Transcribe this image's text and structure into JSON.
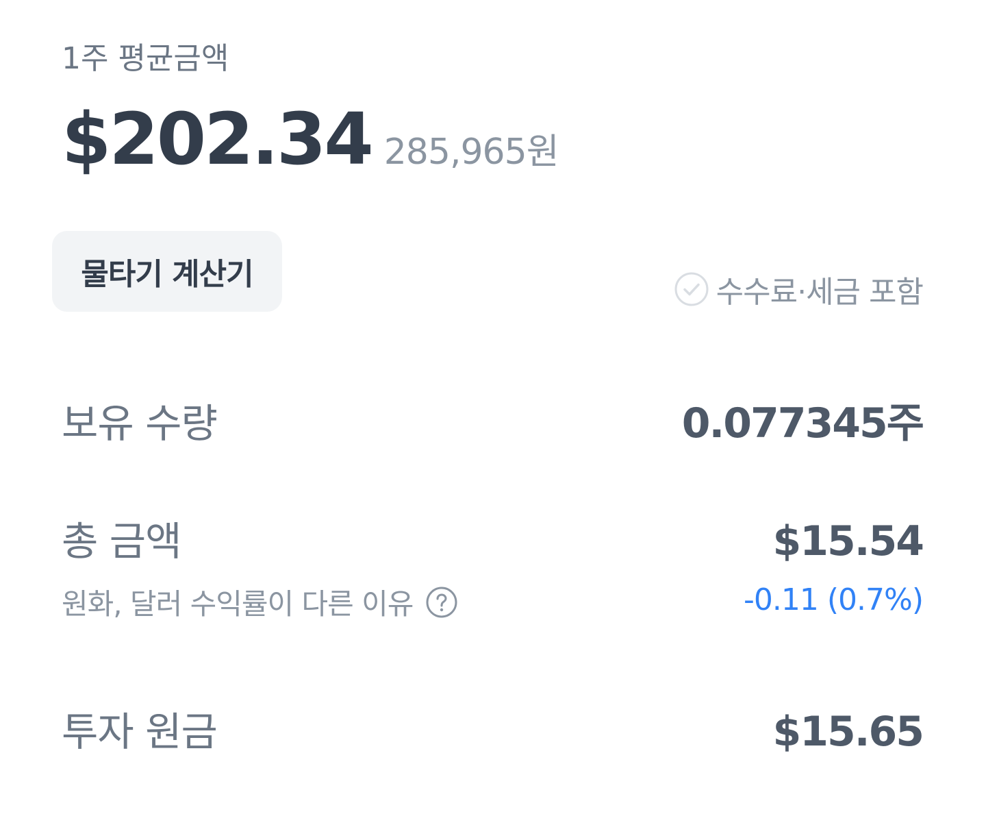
{
  "summary": {
    "avg_label": "1주 평균금액",
    "avg_price_usd": "$202.34",
    "avg_price_krw": "285,965원"
  },
  "actions": {
    "calculator_label": "물타기 계산기",
    "fee_toggle_label": "수수료·세금 포함",
    "fee_toggle_icon": "check-circle-icon"
  },
  "holdings": {
    "quantity_label": "보유 수량",
    "quantity_value": "0.077345주",
    "total_label": "총 금액",
    "total_value": "$15.54",
    "total_help_text": "원화, 달러 수익률이 다른 이유",
    "total_help_icon": "question-circle-icon",
    "total_change": "-0.11 (0.7%)",
    "principal_label": "투자 원금",
    "principal_value": "$15.65"
  },
  "colors": {
    "primary_text": "#333d4b",
    "secondary_text": "#6b7684",
    "muted_text": "#8b95a1",
    "change_blue": "#3182f6",
    "button_bg": "#f2f4f6"
  }
}
